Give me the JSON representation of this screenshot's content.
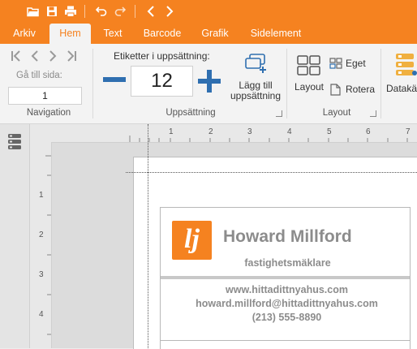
{
  "quick_access": {
    "icons": [
      "open-folder-icon",
      "save-icon",
      "print-icon",
      "undo-icon",
      "redo-icon",
      "previous-icon",
      "next-icon"
    ]
  },
  "tabs": [
    {
      "label": "Arkiv",
      "active": false
    },
    {
      "label": "Hem",
      "active": true
    },
    {
      "label": "Text",
      "active": false
    },
    {
      "label": "Barcode",
      "active": false
    },
    {
      "label": "Grafik",
      "active": false
    },
    {
      "label": "Sidelement",
      "active": false
    }
  ],
  "ribbon": {
    "navigation": {
      "goto_label": "Gå till sida:",
      "page_value": "1",
      "group_label": "Navigation"
    },
    "sets": {
      "caption": "Etiketter i uppsättning:",
      "count_value": "12",
      "add_label_line1": "Lägg till",
      "add_label_line2": "uppsättning",
      "group_label": "Uppsättning"
    },
    "layout": {
      "layout_label": "Layout",
      "custom_label": "Eget",
      "rotate_label": "Rotera",
      "group_label": "Layout"
    },
    "data": {
      "datasource_label": "Datakä"
    }
  },
  "rulers": {
    "top": [
      "1",
      "2",
      "3",
      "4",
      "5",
      "6",
      "7"
    ],
    "left": [
      "1",
      "2",
      "3",
      "4"
    ]
  },
  "label_card": {
    "logo_text": "lj",
    "name": "Howard Millford",
    "title": "fastighetsmäklare",
    "website": "www.hittadittnyahus.com",
    "email": "howard.millford@hittadittnyahus.com",
    "phone": "(213) 555-8890"
  },
  "colors": {
    "accent": "#f58220",
    "icon_blue": "#2f6fb0",
    "card_text": "#8c8c8c"
  }
}
